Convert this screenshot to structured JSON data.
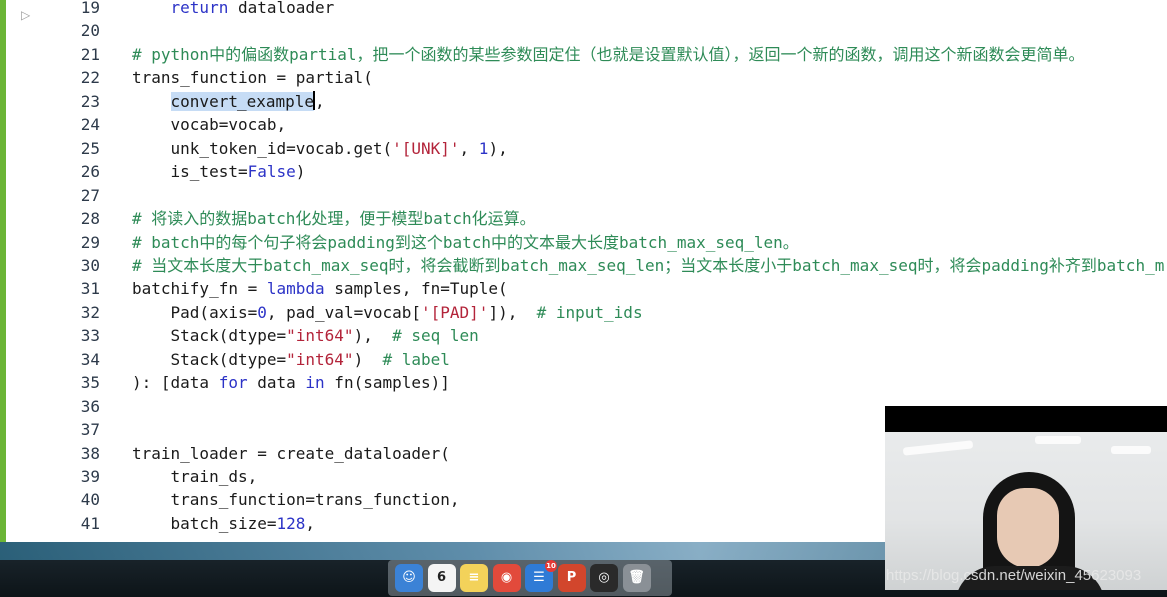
{
  "editor": {
    "lines": [
      {
        "num": "19",
        "segs": [
          {
            "t": "    ",
            "c": ""
          },
          {
            "t": "return",
            "c": "kw"
          },
          {
            "t": " dataloader",
            "c": ""
          }
        ]
      },
      {
        "num": "20",
        "segs": []
      },
      {
        "num": "21",
        "segs": [
          {
            "t": "# python中的偏函数partial，把一个函数的某些参数固定住（也就是设置默认值），返回一个新的函数，调用这个新函数会更简单。",
            "c": "cm"
          }
        ]
      },
      {
        "num": "22",
        "segs": [
          {
            "t": "trans_function = partial(",
            "c": ""
          }
        ]
      },
      {
        "num": "23",
        "segs": [
          {
            "t": "    ",
            "c": ""
          },
          {
            "t": "convert",
            "c": "sel"
          },
          {
            "t": "",
            "c": "ibeam"
          },
          {
            "t": "_example",
            "c": "sel"
          },
          {
            "t": "",
            "c": "caret"
          },
          {
            "t": ",",
            "c": ""
          }
        ]
      },
      {
        "num": "24",
        "segs": [
          {
            "t": "    vocab=vocab,",
            "c": ""
          }
        ]
      },
      {
        "num": "25",
        "segs": [
          {
            "t": "    unk_token_id=vocab.get(",
            "c": ""
          },
          {
            "t": "'[UNK]'",
            "c": "str"
          },
          {
            "t": ", ",
            "c": ""
          },
          {
            "t": "1",
            "c": "num"
          },
          {
            "t": "),",
            "c": ""
          }
        ]
      },
      {
        "num": "26",
        "segs": [
          {
            "t": "    is_test=",
            "c": ""
          },
          {
            "t": "False",
            "c": "kw"
          },
          {
            "t": ")",
            "c": ""
          }
        ]
      },
      {
        "num": "27",
        "segs": []
      },
      {
        "num": "28",
        "segs": [
          {
            "t": "# 将读入的数据batch化处理，便于模型batch化运算。",
            "c": "cm"
          }
        ]
      },
      {
        "num": "29",
        "segs": [
          {
            "t": "# batch中的每个句子将会padding到这个batch中的文本最大长度batch_max_seq_len。",
            "c": "cm"
          }
        ]
      },
      {
        "num": "30",
        "segs": [
          {
            "t": "# 当文本长度大于batch_max_seq时，将会截断到batch_max_seq_len；当文本长度小于batch_max_seq时，将会padding补齐到batch_m",
            "c": "cm"
          }
        ]
      },
      {
        "num": "31",
        "segs": [
          {
            "t": "batchify_fn = ",
            "c": ""
          },
          {
            "t": "lambda",
            "c": "kw"
          },
          {
            "t": " samples, fn=Tuple(",
            "c": ""
          }
        ]
      },
      {
        "num": "32",
        "segs": [
          {
            "t": "    Pad(axis=",
            "c": ""
          },
          {
            "t": "0",
            "c": "num"
          },
          {
            "t": ", pad_val=vocab[",
            "c": ""
          },
          {
            "t": "'[PAD]'",
            "c": "str"
          },
          {
            "t": "]),  ",
            "c": ""
          },
          {
            "t": "# input_ids",
            "c": "cm"
          }
        ]
      },
      {
        "num": "33",
        "segs": [
          {
            "t": "    Stack(dtype=",
            "c": ""
          },
          {
            "t": "\"int64\"",
            "c": "str"
          },
          {
            "t": "),  ",
            "c": ""
          },
          {
            "t": "# seq len",
            "c": "cm"
          }
        ]
      },
      {
        "num": "34",
        "segs": [
          {
            "t": "    Stack(dtype=",
            "c": ""
          },
          {
            "t": "\"int64\"",
            "c": "str"
          },
          {
            "t": ")  ",
            "c": ""
          },
          {
            "t": "# label",
            "c": "cm"
          }
        ]
      },
      {
        "num": "35",
        "segs": [
          {
            "t": "): [data ",
            "c": ""
          },
          {
            "t": "for",
            "c": "kw"
          },
          {
            "t": " data ",
            "c": ""
          },
          {
            "t": "in",
            "c": "kw"
          },
          {
            "t": " fn(samples)]",
            "c": ""
          }
        ]
      },
      {
        "num": "36",
        "segs": []
      },
      {
        "num": "37",
        "segs": []
      },
      {
        "num": "38",
        "segs": [
          {
            "t": "train_loader = create_dataloader(",
            "c": ""
          }
        ]
      },
      {
        "num": "39",
        "segs": [
          {
            "t": "    train_ds,",
            "c": ""
          }
        ]
      },
      {
        "num": "40",
        "segs": [
          {
            "t": "    trans_function=trans_function,",
            "c": ""
          }
        ]
      },
      {
        "num": "41",
        "segs": [
          {
            "t": "    batch_size=",
            "c": ""
          },
          {
            "t": "128",
            "c": "num"
          },
          {
            "t": ",",
            "c": ""
          }
        ]
      }
    ]
  },
  "dock": {
    "items": [
      {
        "name": "finder-icon",
        "glyph": "☺",
        "color": "#3b82d6"
      },
      {
        "name": "calendar-icon",
        "glyph": "6",
        "color": "#f4f4f4"
      },
      {
        "name": "notes-icon",
        "glyph": "≡",
        "color": "#f3d25a"
      },
      {
        "name": "chrome-icon",
        "glyph": "◉",
        "color": "#e24a3b"
      },
      {
        "name": "tasks-icon",
        "glyph": "☰",
        "color": "#2f7bd6",
        "badge": "10"
      },
      {
        "name": "powerpoint-icon",
        "glyph": "P",
        "color": "#d2462c"
      },
      {
        "name": "obs-icon",
        "glyph": "◎",
        "color": "#2a2a2a"
      },
      {
        "name": "trash-icon",
        "glyph": "🗑",
        "color": "#8a9096"
      }
    ]
  },
  "watermark": "https://blog.csdn.net/weixin_45623093"
}
